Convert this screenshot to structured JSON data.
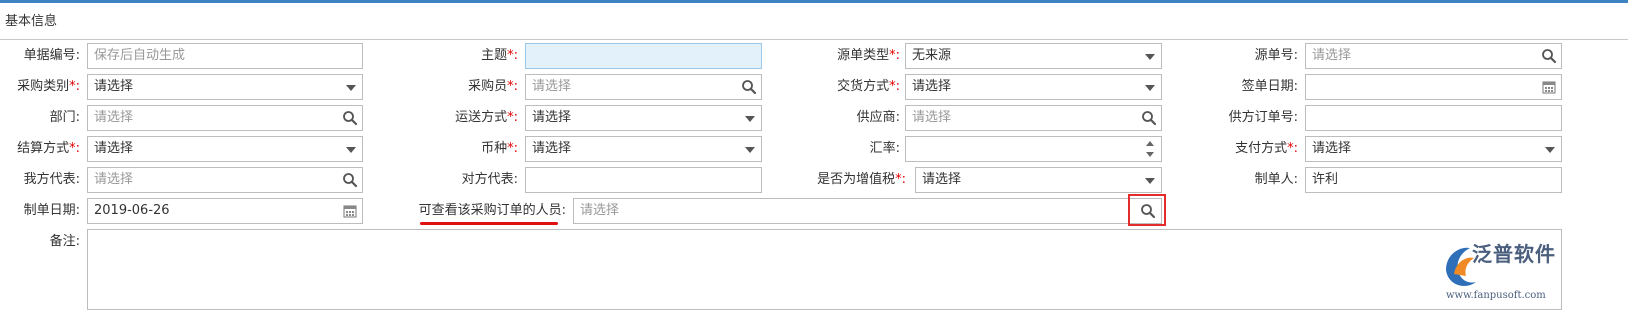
{
  "section": {
    "title": "基本信息"
  },
  "placeholders": {
    "select": "请选择",
    "autogen": "保存后自动生成"
  },
  "labels": {
    "doc_no": "单据编号:",
    "subject": "主题",
    "source_type": "源单类型",
    "source_no": "源单号:",
    "purchase_category": "采购类别",
    "buyer": "采购员",
    "delivery_method": "交货方式",
    "sign_date": "签单日期:",
    "department": "部门:",
    "shipping_method": "运送方式",
    "supplier": "供应商:",
    "supplier_order_no": "供方订单号:",
    "settlement_method": "结算方式",
    "currency": "币种",
    "exchange_rate": "汇率:",
    "payment_method": "支付方式",
    "our_rep": "我方代表:",
    "their_rep": "对方代表:",
    "vat": "是否为增值税",
    "creator": "制单人:",
    "create_date": "制单日期:",
    "viewers": "可查看该采购订单的人员:",
    "remarks": "备注:"
  },
  "values": {
    "source_type": "无来源",
    "purchase_category": "请选择",
    "delivery_method": "请选择",
    "shipping_method": "请选择",
    "settlement_method": "请选择",
    "currency": "请选择",
    "payment_method": "请选择",
    "vat": "请选择",
    "creator": "许利",
    "create_date": "2019-06-26"
  },
  "required_mark": "*:",
  "colon": ":",
  "logo": {
    "text": "泛普软件",
    "url": "www.fanpusoft.com"
  },
  "colors": {
    "accent": "#3e84c4",
    "required": "#e00000",
    "highlight": "#e52c2c",
    "input_focus": "#e3f1fb"
  },
  "icons": [
    "search-icon",
    "chevron-down-icon",
    "calendar-icon",
    "spinner-icon"
  ]
}
